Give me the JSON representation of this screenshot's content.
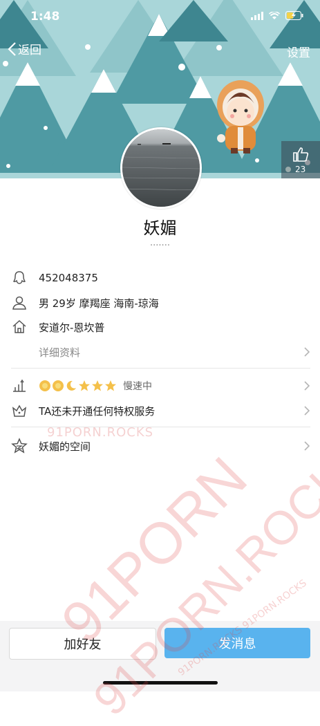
{
  "status_bar": {
    "time": "1:48"
  },
  "nav": {
    "back_label": "返回",
    "settings_label": "设置"
  },
  "likes": {
    "count": "23"
  },
  "profile": {
    "nickname": "妖媚",
    "signature": "·······"
  },
  "info": {
    "qq": "452048375",
    "basic": "男 29岁 摩羯座 海南-琼海",
    "hometown": "安道尔-恩坎普",
    "details_label": "详细资料"
  },
  "level": {
    "status": "慢速中",
    "icons": [
      "sun-icon",
      "sun-icon",
      "moon-icon",
      "star-icon",
      "star-icon",
      "star-icon"
    ]
  },
  "privilege": {
    "text": "TA还未开通任何特权服务"
  },
  "space": {
    "text": "妖媚的空间"
  },
  "buttons": {
    "add_friend": "加好友",
    "send_message": "发消息"
  },
  "watermark": {
    "big": "91PORN",
    "big2": "91PORN.ROCKS",
    "small": "91PORN.ROCKS",
    "mini": "91PORN.ROCKS 91PORN.ROCKS"
  },
  "colors": {
    "header_bg": "#a9d6d9",
    "primary_button": "#59b3ee"
  }
}
